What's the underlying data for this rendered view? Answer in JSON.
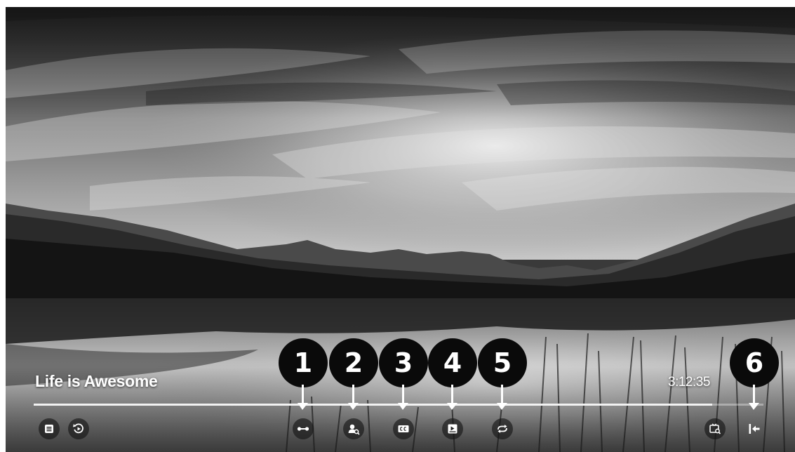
{
  "video": {
    "title": "Life is Awesome",
    "elapsed_time": "3:12:35",
    "progress": 0.93
  },
  "left_controls": [
    {
      "name": "playlist-button",
      "icon": "playlist-icon"
    },
    {
      "name": "replay-button",
      "icon": "replay-icon"
    }
  ],
  "center_controls": [
    {
      "name": "ab-repeat-button",
      "icon": "link-icon",
      "callout": "1"
    },
    {
      "name": "user-profile-button",
      "icon": "user-search-icon",
      "callout": "2"
    },
    {
      "name": "subtitles-button",
      "icon": "cc-icon",
      "callout": "3"
    },
    {
      "name": "picture-button",
      "icon": "picture-icon",
      "callout": "4"
    },
    {
      "name": "repeat-button",
      "icon": "repeat-icon",
      "callout": "5"
    }
  ],
  "right_controls": [
    {
      "name": "scene-search-button",
      "icon": "scene-search-icon"
    },
    {
      "name": "exit-button",
      "icon": "exit-icon",
      "callout": "6"
    }
  ],
  "colors": {
    "overlay_text": "#ffffff",
    "callout_fill": "#0a0a0a",
    "button_fill": "#141414"
  }
}
